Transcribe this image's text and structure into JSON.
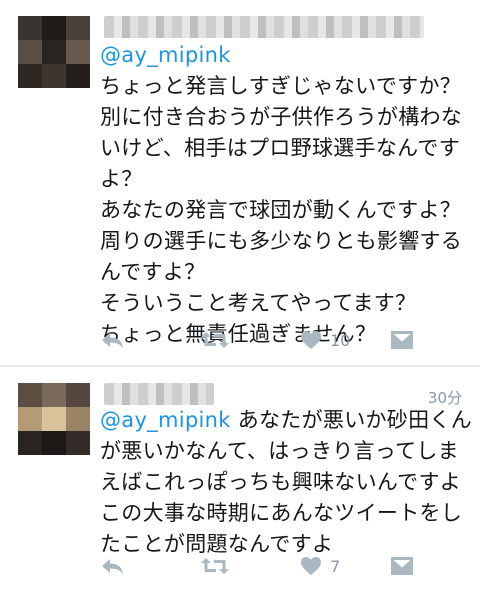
{
  "tweets": [
    {
      "mention": "@ay_mipink",
      "lines": [
        "ちょっと発言しすぎじゃないですか？",
        "別に付き合おうが子供作ろうが構わな",
        "いけど、相手はプロ野球選手なんです",
        "よ？",
        "あなたの発言で球団が動くんですよ？",
        "周りの選手にも多少なりとも影響する",
        "んですよ？",
        "そういうこと考えてやってます？",
        "ちょっと無責任過ぎません？"
      ],
      "timestamp": "",
      "like_count": "10",
      "icons": [
        "reply-icon",
        "retweet-icon",
        "heart-icon",
        "dm-icon"
      ]
    },
    {
      "mention": "@ay_mipink",
      "lines": [
        " あなたが悪いか砂田くん",
        "が悪いかなんて、はっきり言ってしま",
        "えばこれっぽっちも興味ないんですよ",
        "この大事な時期にあんなツイートをし",
        "たことが問題なんですよ"
      ],
      "timestamp": "30分",
      "like_count": "7",
      "icons": [
        "reply-icon",
        "retweet-icon",
        "heart-icon",
        "dm-icon"
      ]
    }
  ],
  "colors": {
    "mention": "#1b95e0",
    "icon": "#aab8c2",
    "meta": "#8899a6",
    "divider": "#e1e8ed"
  }
}
